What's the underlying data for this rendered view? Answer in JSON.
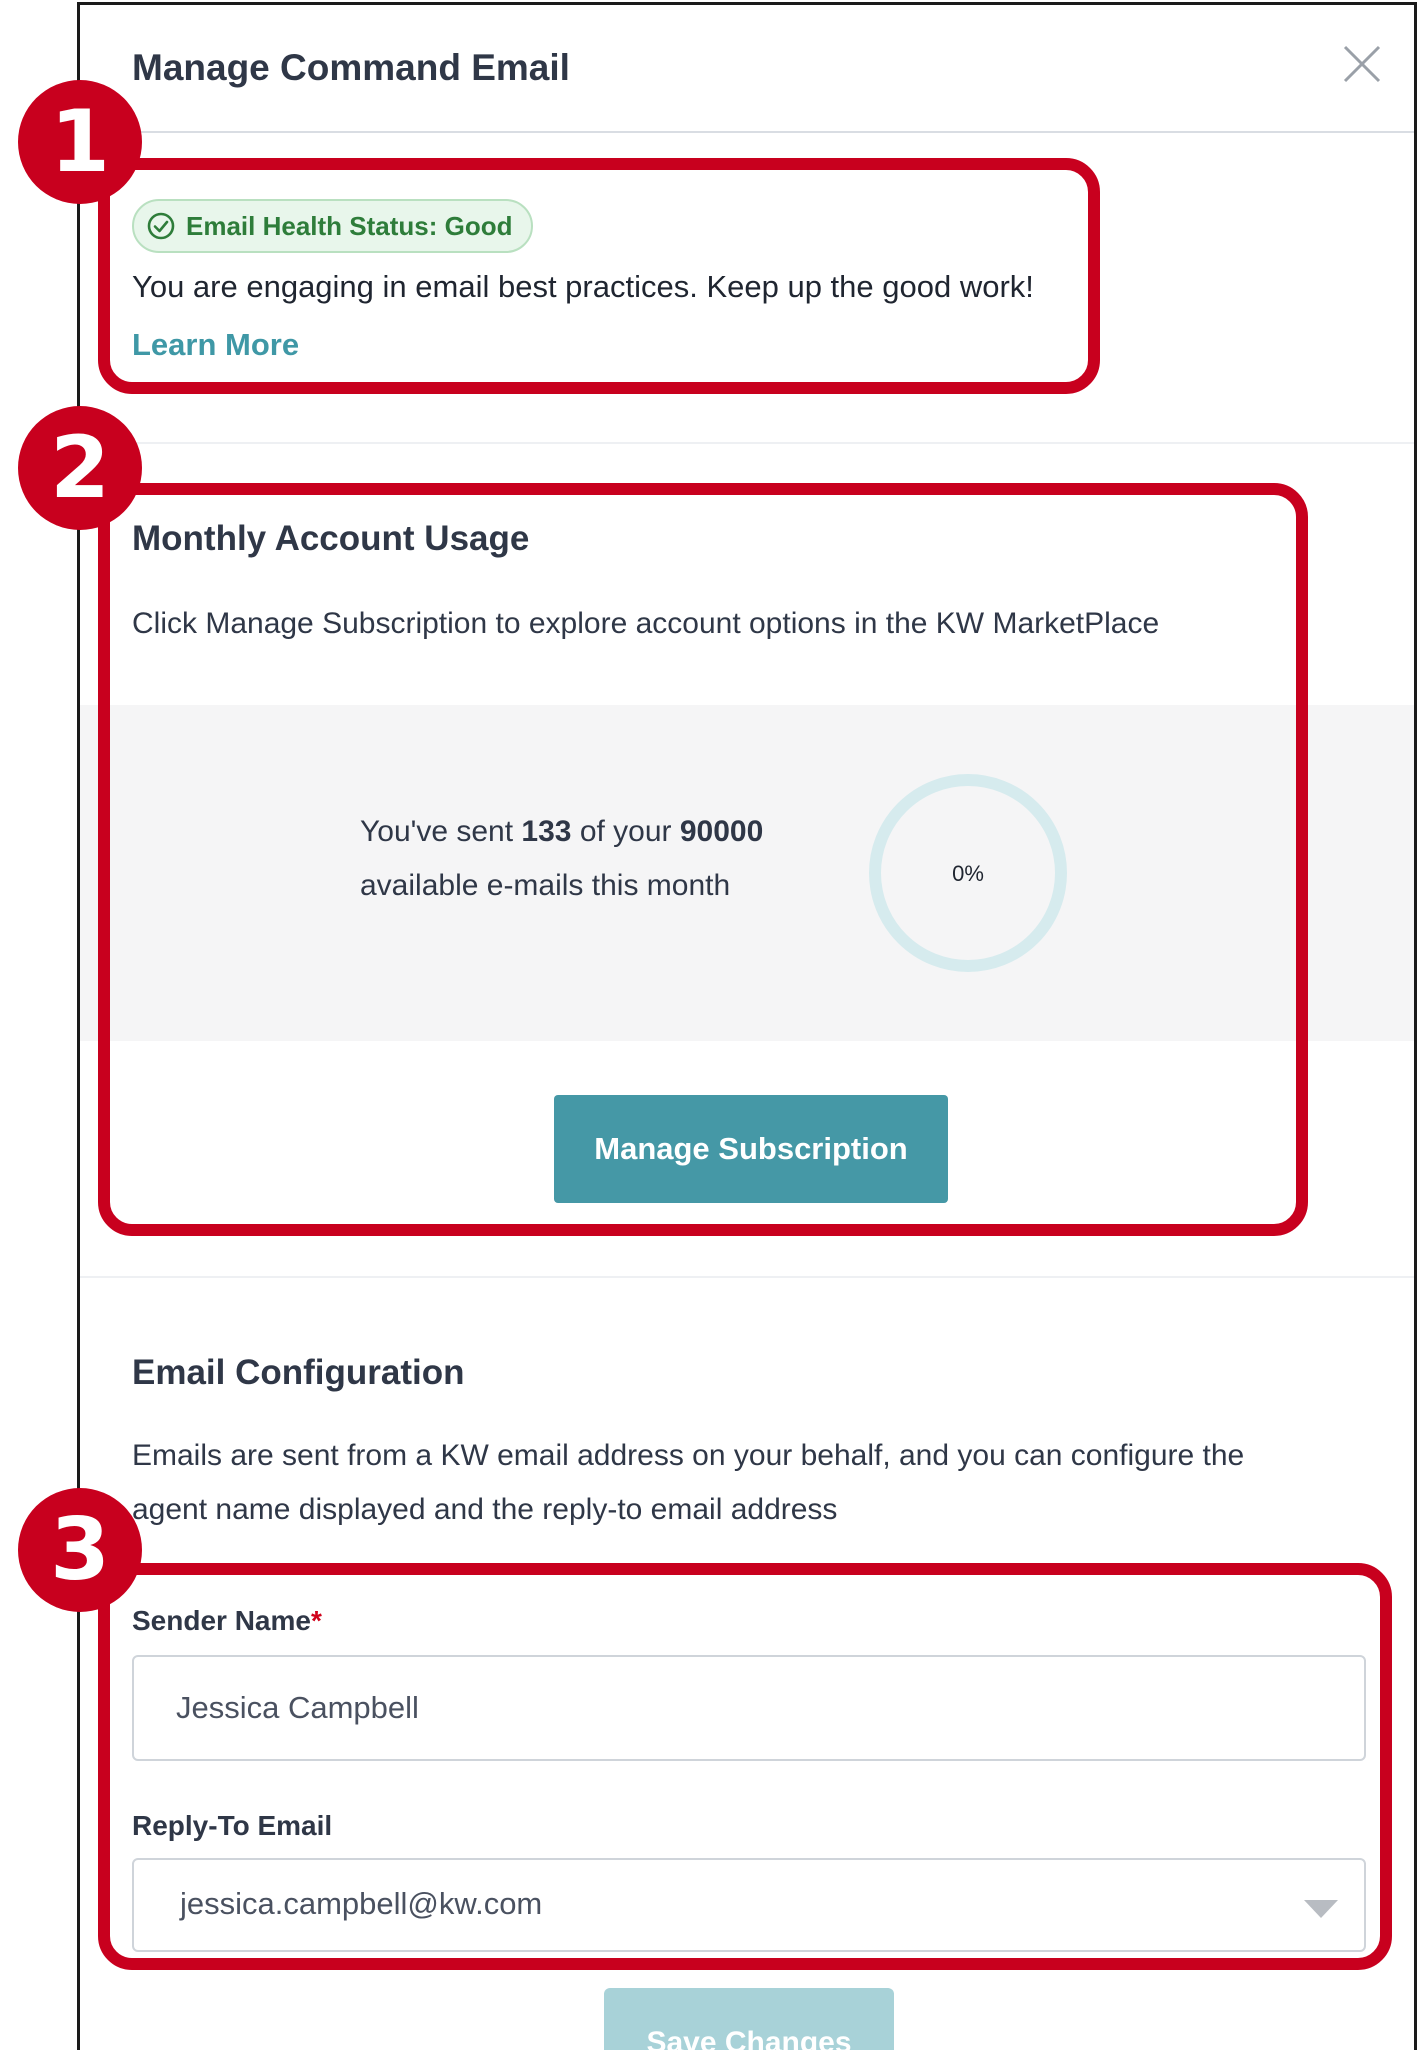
{
  "modal": {
    "title": "Manage Command Email",
    "close_icon": "close-icon"
  },
  "health": {
    "status_label": "Email Health Status: Good",
    "status_icon": "check-circle-icon",
    "status_color": "#2e7d3a",
    "description": "You are engaging in email best practices. Keep up the good work!",
    "learn_more": "Learn More"
  },
  "usage": {
    "title": "Monthly Account Usage",
    "description": "Click Manage Subscription to explore account options in the KW MarketPlace",
    "sent_prefix": "You've sent ",
    "sent_count": "133",
    "sent_middle": " of your ",
    "total": "90000",
    "sent_suffix": "available e-mails this month",
    "percent_label": "0%",
    "percent_value": 0,
    "manage_button": "Manage Subscription"
  },
  "config": {
    "title": "Email Configuration",
    "description_line1": "Emails are sent from a KW email address on your behalf, and you can configure the",
    "description_line2": "agent name displayed and the reply-to email address",
    "sender_label": "Sender Name",
    "required_mark": "*",
    "sender_value": "Jessica Campbell",
    "reply_label": "Reply-To Email",
    "reply_value": "jessica.campbell@kw.com",
    "save_button": "Save Changes"
  },
  "callouts": {
    "one": "1",
    "two": "2",
    "three": "3",
    "color": "#c8001e"
  },
  "colors": {
    "accent": "#4598a6",
    "link": "#3f98a6"
  }
}
